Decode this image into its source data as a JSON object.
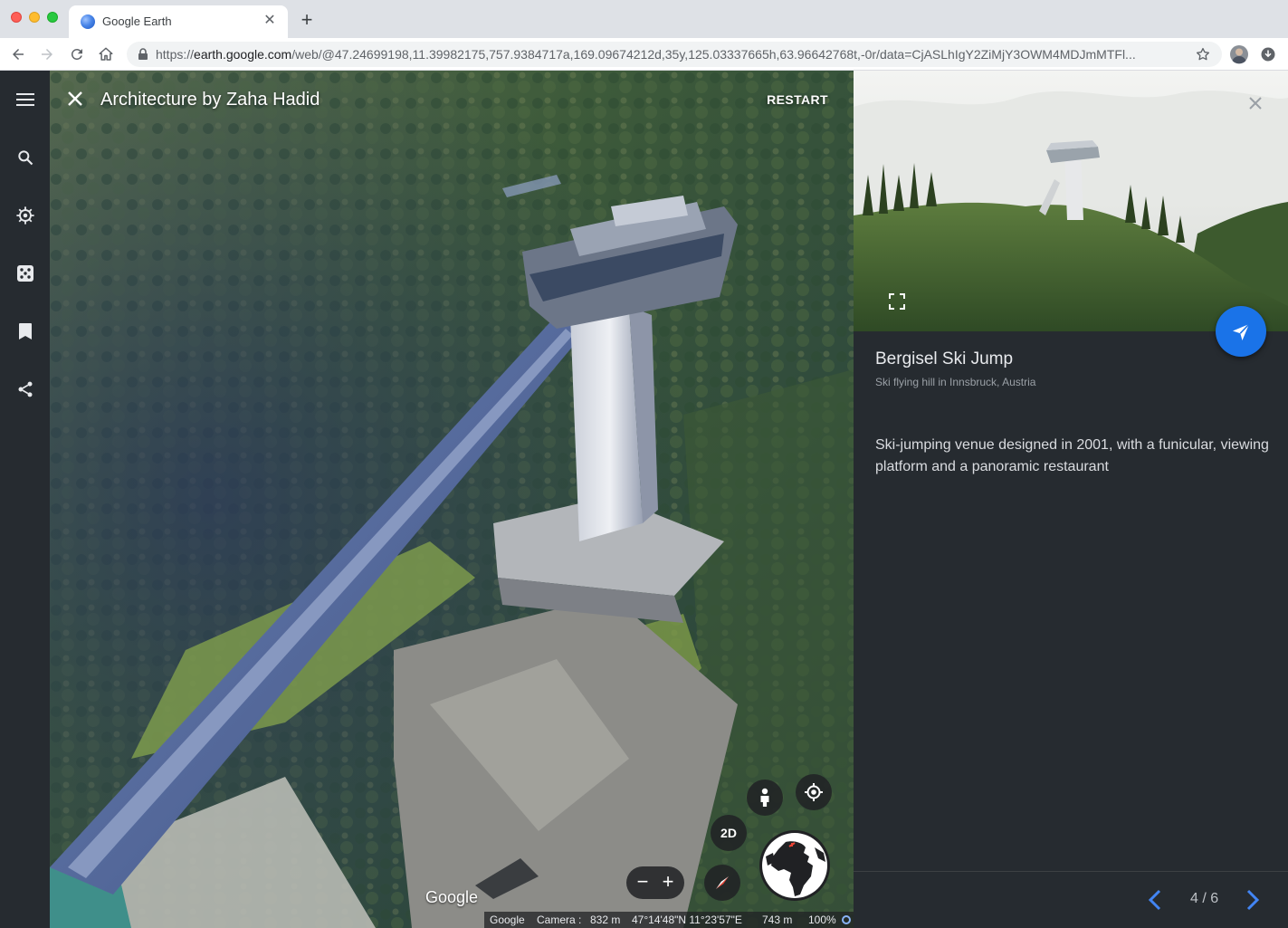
{
  "browser": {
    "tab_title": "Google Earth",
    "url_scheme": "https://",
    "url_host": "earth.google.com",
    "url_path": "/web/@47.24699198,11.39982175,757.9384717a,169.09674212d,35y,125.03337665h,63.96642768t,-0r/data=CjASLhIgY2ZiMjY3OWM4MDJmMTFl..."
  },
  "rail": {
    "items": [
      "menu-icon",
      "search-icon",
      "voyager-icon",
      "feeling-lucky-icon",
      "projects-icon",
      "share-icon"
    ]
  },
  "viewport": {
    "tour_title": "Architecture by Zaha Hadid",
    "restart_label": "RESTART",
    "view_mode_label": "2D",
    "zoom_out_label": "−",
    "zoom_in_label": "+",
    "watermark": "Google",
    "status": {
      "attribution": "Google",
      "camera_label": "Camera :",
      "camera_alt": "832 m",
      "coordinates": "47°14'48\"N 11°23'57\"E",
      "ground_alt": "743 m",
      "loaded": "100%"
    }
  },
  "card": {
    "title": "Bergisel Ski Jump",
    "subtitle": "Ski flying hill in Innsbruck, Austria",
    "description": "Ski-jumping venue designed in 2001, with a funicular, viewing platform and a panoramic restaurant",
    "page_indicator": "4 / 6"
  },
  "colors": {
    "rail_bg": "#262b30",
    "card_bg": "#262b30",
    "accent": "#1a73e8",
    "nav_arrow": "#4285f4"
  }
}
